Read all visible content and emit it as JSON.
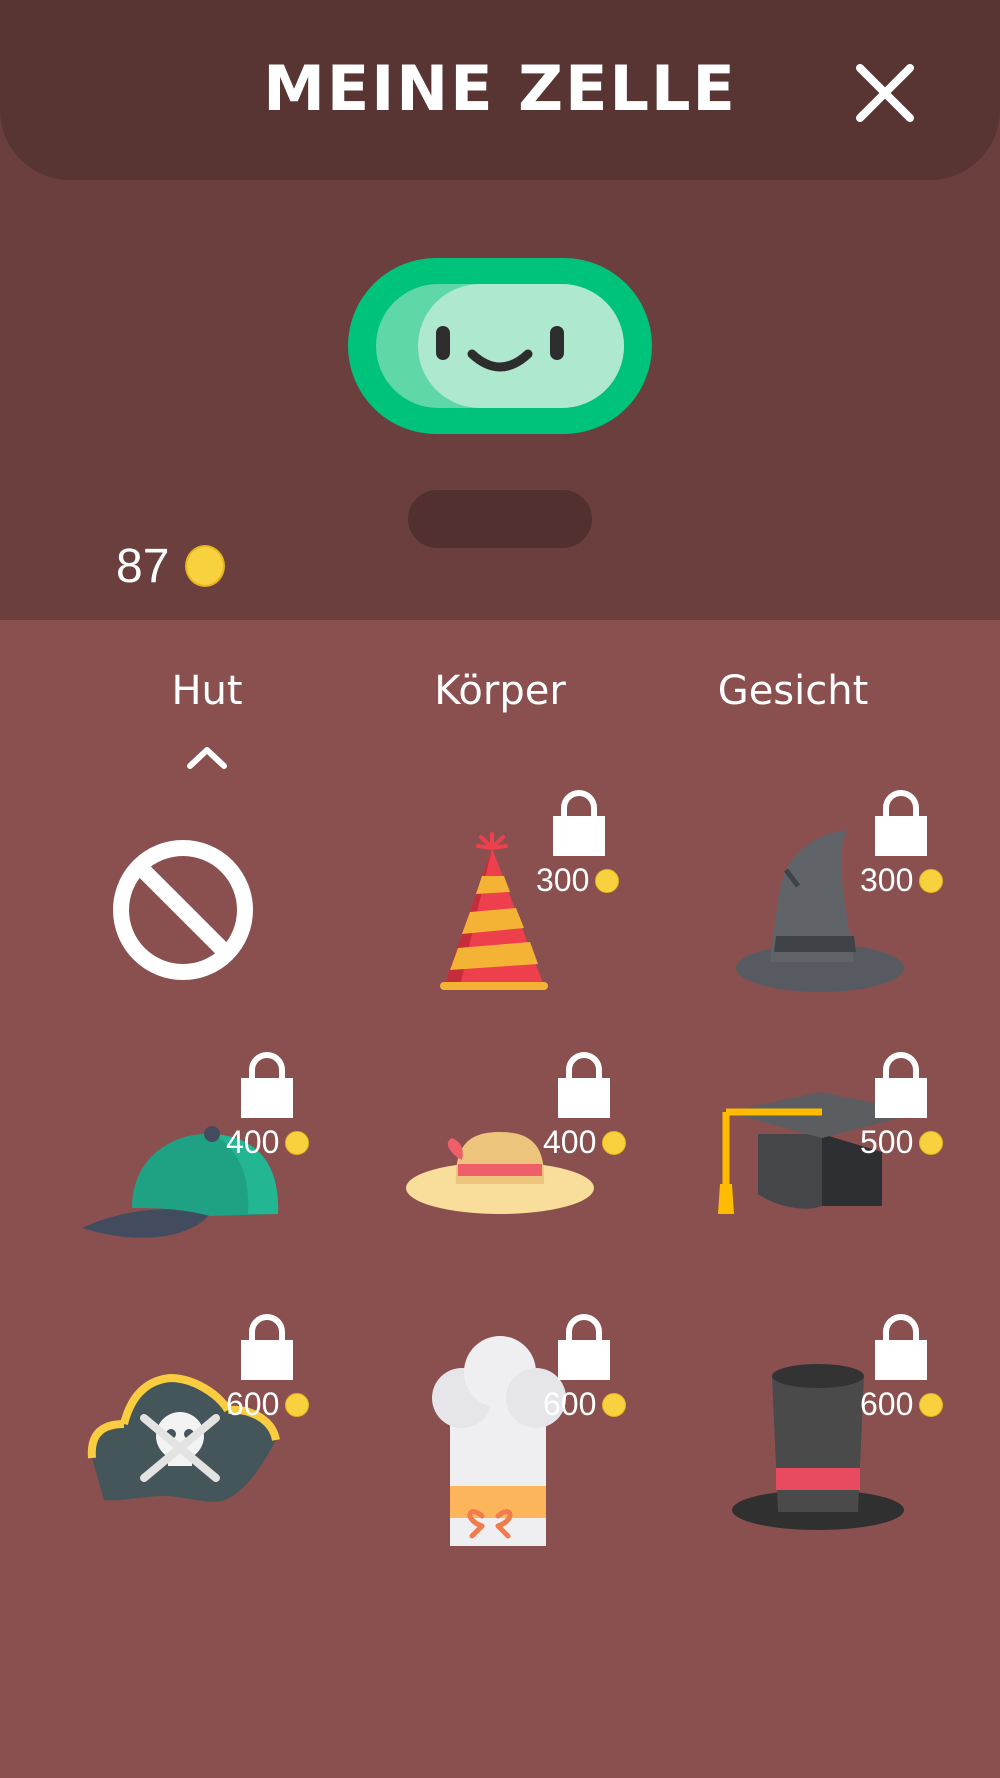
{
  "header": {
    "title": "MEINE ZELLE",
    "close_icon": "close-icon"
  },
  "balance": {
    "amount": "87",
    "icon": "coin-icon"
  },
  "tabs": [
    {
      "label": "Hut",
      "active": true
    },
    {
      "label": "Körper",
      "active": false
    },
    {
      "label": "Gesicht",
      "active": false
    }
  ],
  "items": [
    {
      "name": "none",
      "icon": "no-hat-icon",
      "price": ""
    },
    {
      "name": "party-hat",
      "icon": "party-hat-icon",
      "price": "300",
      "locked": true
    },
    {
      "name": "witch-hat",
      "icon": "witch-hat-icon",
      "price": "300",
      "locked": true
    },
    {
      "name": "cap",
      "icon": "cap-icon",
      "price": "400",
      "locked": true
    },
    {
      "name": "sun-hat",
      "icon": "sun-hat-icon",
      "price": "400",
      "locked": true
    },
    {
      "name": "graduation-cap",
      "icon": "graduation-cap-icon",
      "price": "500",
      "locked": true
    },
    {
      "name": "pirate-hat",
      "icon": "pirate-hat-icon",
      "price": "600",
      "locked": true
    },
    {
      "name": "chef-hat",
      "icon": "chef-hat-icon",
      "price": "600",
      "locked": true
    },
    {
      "name": "top-hat",
      "icon": "top-hat-icon",
      "price": "600",
      "locked": true
    }
  ],
  "colors": {
    "header_bg": "#583533",
    "top_bg": "#6b3f3d",
    "panel_bg": "#8a504f",
    "avatar_green": "#00c37b",
    "coin": "#f7d23e"
  }
}
